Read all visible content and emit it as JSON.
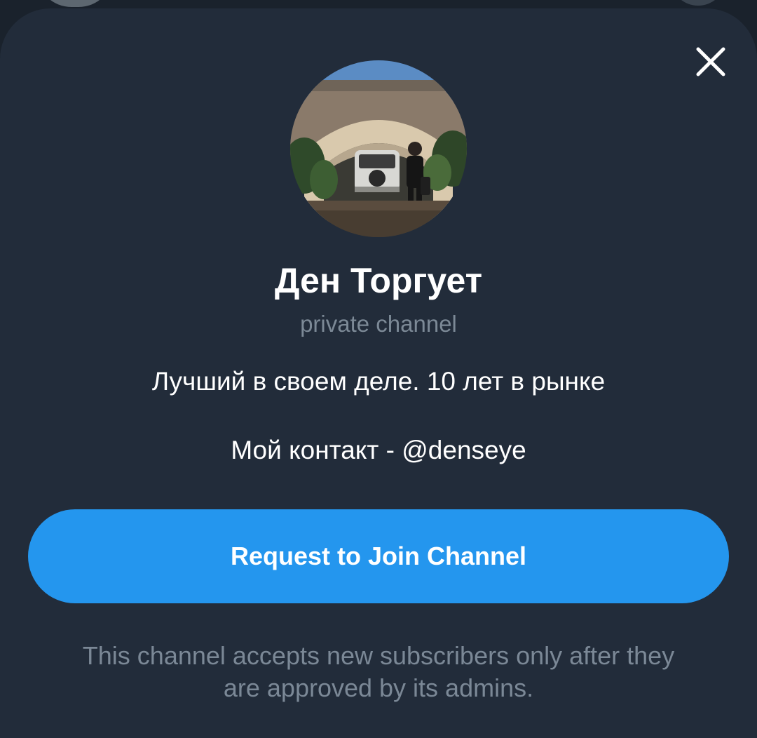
{
  "colors": {
    "background": "#1a222c",
    "sheet": "#222c3a",
    "accent": "#2496ee",
    "title": "#ffffff",
    "muted": "#7c8996"
  },
  "icons": {
    "close": "close-icon"
  },
  "channel": {
    "title": "Ден Торгует",
    "type": "private channel",
    "description_lines": [
      "Лучший в своем деле. 10 лет в рынке",
      "Мой контакт - @denseye"
    ]
  },
  "actions": {
    "join_label": "Request to Join Channel"
  },
  "note": {
    "line1": "This channel accepts new subscribers only after they",
    "line2": "are approved by its admins."
  }
}
